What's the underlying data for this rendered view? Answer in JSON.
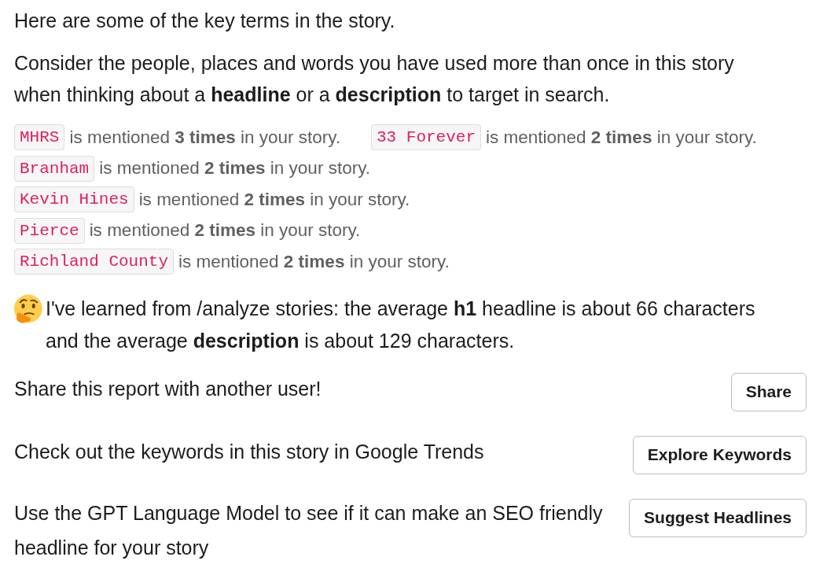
{
  "intro": "Here are some of the key terms in the story.",
  "advice": "Consider the people, places and words you have used more than once in this story when thinking about a **headline** or a **description** to target in search.",
  "mention_rows": [
    {
      "items": [
        {
          "term": "MHRS",
          "text": "is mentioned **3 times** in your story."
        },
        {
          "term": "33 Forever",
          "text": "is mentioned **2 times** in your story."
        }
      ]
    },
    {
      "items": [
        {
          "term": "Branham",
          "text": "is mentioned **2 times** in your story."
        }
      ]
    },
    {
      "items": [
        {
          "term": "Kevin Hines",
          "text": "is mentioned **2 times** in your story."
        }
      ]
    },
    {
      "items": [
        {
          "term": "Pierce",
          "text": "is mentioned **2 times** in your story."
        }
      ]
    },
    {
      "items": [
        {
          "term": "Richland County",
          "text": "is mentioned **2 times** in your story."
        }
      ]
    }
  ],
  "insight": "I've learned from /analyze stories: the average **h1** headline is about 66 characters and the average **description** is about 129 characters.",
  "actions": [
    {
      "text": "Share this report with another user!",
      "button": "Share"
    },
    {
      "text": "Check out the keywords in this story in Google Trends",
      "button": "Explore Keywords"
    },
    {
      "text": "Use the GPT Language Model to see if it can make an SEO friendly headline for your story",
      "button": "Suggest Headlines"
    }
  ]
}
